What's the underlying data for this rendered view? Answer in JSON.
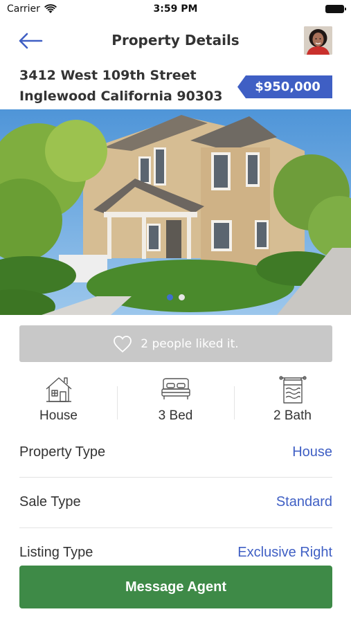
{
  "status_bar": {
    "carrier": "Carrier",
    "time": "3:59 PM"
  },
  "nav": {
    "title": "Property Details"
  },
  "property": {
    "address_line1": "3412 West 109th Street",
    "address_line2": "Inglewood California 90303",
    "price": "$950,000"
  },
  "gallery": {
    "slide_count": 2,
    "active_slide": 1
  },
  "likes": {
    "text": "2 people liked it."
  },
  "features": [
    {
      "icon": "house-icon",
      "label": "House"
    },
    {
      "icon": "bed-icon",
      "label": "3 Bed"
    },
    {
      "icon": "bath-icon",
      "label": "2 Bath"
    }
  ],
  "details": [
    {
      "label": "Property Type",
      "value": "House"
    },
    {
      "label": "Sale Type",
      "value": "Standard"
    },
    {
      "label": "Listing Type",
      "value": "Exclusive Right"
    }
  ],
  "cta": {
    "label": "Message Agent"
  },
  "colors": {
    "accent": "#3f5fc4",
    "cta": "#3e8a47",
    "like_bar": "#c8c8c8"
  }
}
